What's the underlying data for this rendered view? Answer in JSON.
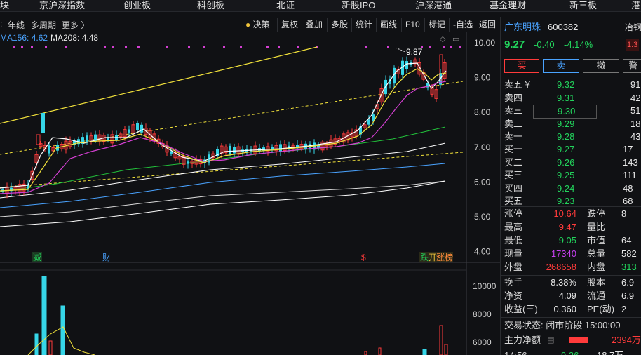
{
  "topnav": [
    "块",
    "京沪深指数",
    "创业板",
    "科创板",
    "北证",
    "新股IPO",
    "沪深港通",
    "基金理财",
    "新三板",
    "港"
  ],
  "toolbar": {
    "left_items": [
      "年线",
      "多周期",
      "更多 〉"
    ],
    "buttons": [
      "决策",
      "复权",
      "叠加",
      "多股",
      "统计",
      "画线",
      "F10",
      "标记",
      "-自选",
      "返回"
    ]
  },
  "ma_legend": {
    "ma156": "MA156: 4.62",
    "ma208": "MA208: 4.48"
  },
  "price_axis": [
    "10.00",
    "9.00",
    "8.00",
    "7.00",
    "6.00",
    "5.00",
    "4.00"
  ],
  "volume_axis": [
    "10000",
    "8000",
    "6000"
  ],
  "peak_label": "9.87",
  "event_markers": [
    "减",
    "财",
    "$",
    "跌",
    "开",
    "涨榜"
  ],
  "stock": {
    "name": "广东明珠",
    "code": "600382",
    "price": "9.27",
    "change": "-0.40",
    "pct": "-4.14%",
    "side_label": "冶钢",
    "side_value": "1.3"
  },
  "actions": {
    "buy": "买",
    "sell": "卖",
    "cancel": "撤",
    "more": "警"
  },
  "asks": [
    {
      "label": "卖五 ¥",
      "price": "9.32",
      "vol": "91"
    },
    {
      "label": "卖四",
      "price": "9.31",
      "vol": "42"
    },
    {
      "label": "卖三",
      "price": "9.30",
      "vol": "51"
    },
    {
      "label": "卖二",
      "price": "9.29",
      "vol": "18"
    },
    {
      "label": "卖一",
      "price": "9.28",
      "vol": "43"
    }
  ],
  "bids": [
    {
      "label": "买一",
      "price": "9.27",
      "vol": "17"
    },
    {
      "label": "买二",
      "price": "9.26",
      "vol": "143"
    },
    {
      "label": "买三",
      "price": "9.25",
      "vol": "111"
    },
    {
      "label": "买四",
      "price": "9.24",
      "vol": "48"
    },
    {
      "label": "买五",
      "price": "9.23",
      "vol": "68"
    }
  ],
  "stats": [
    {
      "k1": "涨停",
      "v1": "10.64",
      "k2": "跌停",
      "v2": "8"
    },
    {
      "k1": "最高",
      "v1": "9.47",
      "k2": "量比",
      "v2": ""
    },
    {
      "k1": "最低",
      "v1": "9.05",
      "k2": "市值",
      "v2": "64"
    },
    {
      "k1": "现量",
      "v1": "17340",
      "k2": "总量",
      "v2": "582"
    },
    {
      "k1": "外盘",
      "v1": "268658",
      "k2": "内盘",
      "v2": "313"
    }
  ],
  "fundamentals": [
    {
      "k1": "换手",
      "v1": "8.38%",
      "k2": "股本",
      "v2": "6.9"
    },
    {
      "k1": "净资",
      "v1": "4.09",
      "k2": "流通",
      "v2": "6.9"
    },
    {
      "k1": "收益(三)",
      "v1": "0.360",
      "k2": "PE(动)",
      "v2": "2"
    }
  ],
  "trade_status": "交易状态: 闭市阶段 15:00:00",
  "main_flow": {
    "label": "主力净额",
    "value": "2394万"
  },
  "tick_row": {
    "time": "14:56",
    "price": "9.26",
    "vol": "18.7万"
  },
  "colors": {
    "up": "#ff3b3b",
    "down": "#22d35c",
    "ma5": "#ffffff",
    "ma10": "#f2e23b",
    "ma20": "#d43fd2",
    "accent": "#4aa3ff"
  }
}
